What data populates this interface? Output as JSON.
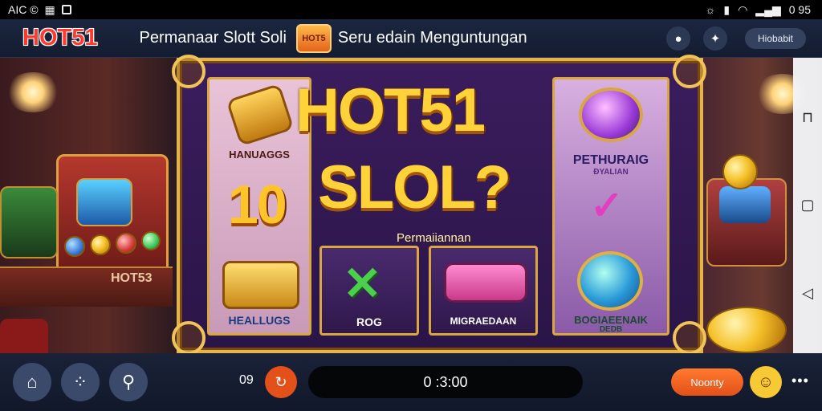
{
  "status_bar": {
    "left_text": "AIC ©",
    "right_text": "0 95",
    "icons": [
      "carousel-icon",
      "tv-icon",
      "notification-icon",
      "battery-icon",
      "wifi-icon",
      "signal-icon"
    ]
  },
  "header": {
    "logo": "HOT51",
    "title_left": "Permanaar Slott Soli",
    "badge": "HOT5",
    "title_right": "Seru edain Menguntungan",
    "right_button": "Hiobabit",
    "icons": [
      "game-icon",
      "dice-icon"
    ]
  },
  "game": {
    "title_line1": "HOT51",
    "title_line2": "SLOL?",
    "subtitle": "Permaiiannan",
    "big_number": "10",
    "left_top_label": "HANUAGGS",
    "left_bottom_label": "HEALLUGS",
    "right_top_label": "PETHURAIG",
    "right_top_sublabel": "ÐYALIAN",
    "right_bottom_label": "BOGIAEENAIK",
    "right_bottom_sublabel": "DEDB",
    "mid_left_label": "ROG",
    "mid_right_label": "MIGRAEDAAN",
    "machine_label": "HOT53"
  },
  "bottom_bar": {
    "count": "09",
    "timer": "0 :3:00",
    "play_label": "Noonty",
    "icons": [
      "home-icon",
      "apps-icon",
      "location-pin-icon",
      "refresh-icon",
      "face-icon",
      "more-icon"
    ]
  },
  "colors": {
    "accent_orange": "#e3501a",
    "gold": "#e4b44a",
    "frame_purple": "#3b1d5e",
    "header_bg": "#1b2640"
  }
}
